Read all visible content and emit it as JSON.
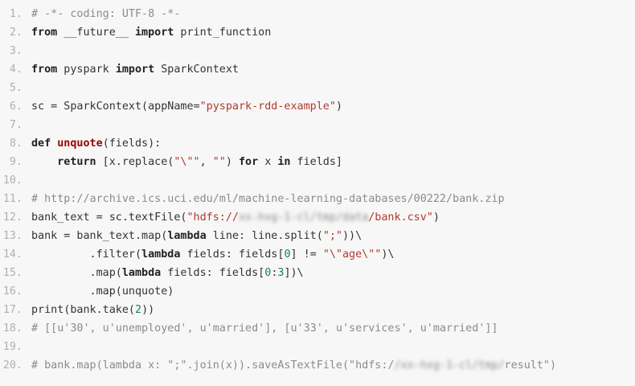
{
  "lines": [
    {
      "n": "1.",
      "t": [
        [
          "cm",
          "# -*- coding: UTF-8 -*-"
        ]
      ]
    },
    {
      "n": "2.",
      "t": [
        [
          "kw",
          "from"
        ],
        [
          "",
          " __future__ "
        ],
        [
          "kw",
          "import"
        ],
        [
          "",
          " print_function"
        ]
      ]
    },
    {
      "n": "3.",
      "t": []
    },
    {
      "n": "4.",
      "t": [
        [
          "kw",
          "from"
        ],
        [
          "",
          " pyspark "
        ],
        [
          "kw",
          "import"
        ],
        [
          "",
          " SparkContext"
        ]
      ]
    },
    {
      "n": "5.",
      "t": []
    },
    {
      "n": "6.",
      "t": [
        [
          "",
          "sc = SparkContext(appName="
        ],
        [
          "str",
          "\"pyspark-rdd-example\""
        ],
        [
          "",
          ")"
        ]
      ]
    },
    {
      "n": "7.",
      "t": []
    },
    {
      "n": "8.",
      "t": [
        [
          "kw",
          "def"
        ],
        [
          "",
          " "
        ],
        [
          "fn",
          "unquote"
        ],
        [
          "",
          "(fields):"
        ]
      ]
    },
    {
      "n": "9.",
      "t": [
        [
          "",
          "    "
        ],
        [
          "kw",
          "return"
        ],
        [
          "",
          " [x.replace("
        ],
        [
          "str",
          "\"\\\"\""
        ],
        [
          "",
          ", "
        ],
        [
          "str",
          "\"\""
        ],
        [
          "",
          ") "
        ],
        [
          "kw",
          "for"
        ],
        [
          "",
          " x "
        ],
        [
          "kw",
          "in"
        ],
        [
          "",
          " fields]"
        ]
      ]
    },
    {
      "n": "10.",
      "t": []
    },
    {
      "n": "11.",
      "t": [
        [
          "cm",
          "# http://archive.ics.uci.edu/ml/machine-learning-databases/00222/bank.zip"
        ]
      ]
    },
    {
      "n": "12.",
      "t": [
        [
          "",
          "bank_text = sc.textFile("
        ],
        [
          "str",
          "\"hdfs://"
        ],
        [
          "blur",
          "xx-hxg-1-cl/tmp/data"
        ],
        [
          "str",
          "/bank.csv\""
        ],
        [
          "",
          ")"
        ]
      ]
    },
    {
      "n": "13.",
      "t": [
        [
          "",
          "bank = bank_text.map("
        ],
        [
          "kw",
          "lambda"
        ],
        [
          "",
          " line: line.split("
        ],
        [
          "str",
          "\";\""
        ],
        [
          "",
          "))\\"
        ]
      ]
    },
    {
      "n": "14.",
      "t": [
        [
          "",
          "         .filter("
        ],
        [
          "kw",
          "lambda"
        ],
        [
          "",
          " fields: fields["
        ],
        [
          "num",
          "0"
        ],
        [
          "",
          "] != "
        ],
        [
          "str",
          "\"\\\"age\\\"\""
        ],
        [
          "",
          ")\\"
        ]
      ]
    },
    {
      "n": "15.",
      "t": [
        [
          "",
          "         .map("
        ],
        [
          "kw",
          "lambda"
        ],
        [
          "",
          " fields: fields["
        ],
        [
          "num",
          "0"
        ],
        [
          "",
          ":"
        ],
        [
          "num",
          "3"
        ],
        [
          "",
          "])\\"
        ]
      ]
    },
    {
      "n": "16.",
      "t": [
        [
          "",
          "         .map(unquote)"
        ]
      ]
    },
    {
      "n": "17.",
      "t": [
        [
          "",
          "print(bank.take("
        ],
        [
          "num",
          "2"
        ],
        [
          "",
          "))"
        ]
      ]
    },
    {
      "n": "18.",
      "t": [
        [
          "cm",
          "# [[u'30', u'unemployed', u'married'], [u'33', u'services', u'married']]"
        ]
      ]
    },
    {
      "n": "19.",
      "t": []
    },
    {
      "n": "20.",
      "t": [
        [
          "cm",
          "# bank.map(lambda x: \";\".join(x)).saveAsTextFile(\"hdfs:/"
        ],
        [
          "blur",
          "/xx-hxg-1-cl/tmp/"
        ],
        [
          "cm",
          "result\")"
        ]
      ]
    }
  ],
  "colors": {
    "background": "#f7f7f7",
    "text": "#333333",
    "line_number": "#b0b0b0",
    "keyword": "#222222",
    "function_name": "#990000",
    "string": "#b03a2e",
    "number": "#16855b",
    "comment": "#8b8b8b"
  }
}
